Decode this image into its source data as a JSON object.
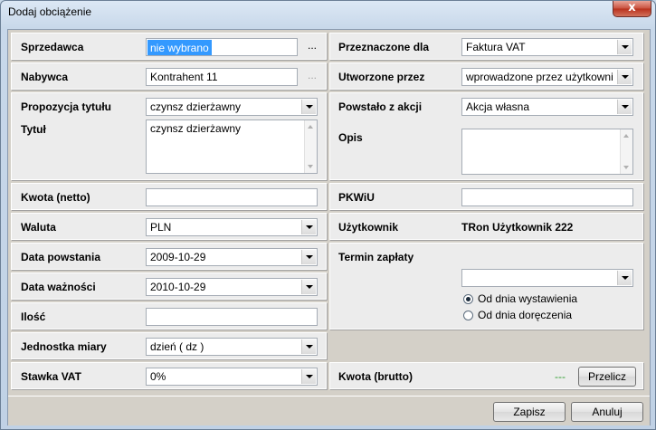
{
  "window": {
    "title": "Dodaj obciążenie",
    "close_label": "x"
  },
  "left": {
    "sprzedawca": {
      "label": "Sprzedawca",
      "value": "nie wybrano",
      "dots": "..."
    },
    "nabywca": {
      "label": "Nabywca",
      "value": "Kontrahent 11",
      "dots": "..."
    },
    "propozycja": {
      "label": "Propozycja tytułu",
      "value": "czynsz dzierżawny"
    },
    "tytul": {
      "label": "Tytuł",
      "value": "czynsz dzierżawny"
    },
    "kwota_netto": {
      "label": "Kwota (netto)",
      "value": ""
    },
    "waluta": {
      "label": "Waluta",
      "value": "PLN"
    },
    "data_powstania": {
      "label": "Data powstania",
      "value": "2009-10-29"
    },
    "data_waznosci": {
      "label": "Data ważności",
      "value": "2010-10-29"
    },
    "ilosc": {
      "label": "Ilość",
      "value": ""
    },
    "jednostka": {
      "label": "Jednostka miary",
      "value": "dzień ( dz )"
    },
    "stawka": {
      "label": "Stawka VAT",
      "value": "0%"
    }
  },
  "right": {
    "przeznaczone": {
      "label": "Przeznaczone dla",
      "value": "Faktura VAT"
    },
    "utworzone": {
      "label": "Utworzone przez",
      "value": "wprowadzone przez użytkowni"
    },
    "powstalo": {
      "label": "Powstało z akcji",
      "value": "Akcja własna"
    },
    "opis": {
      "label": "Opis",
      "value": ""
    },
    "pkwiu": {
      "label": "PKWiU",
      "value": ""
    },
    "uzytkownik": {
      "label": "Użytkownik",
      "value": "TRon Użytkownik 222"
    },
    "termin": {
      "label": "Termin zapłaty",
      "value": "",
      "options": [
        {
          "label": "Od dnia wystawienia",
          "checked": true
        },
        {
          "label": "Od dnia doręczenia",
          "checked": false
        }
      ]
    },
    "kwota_brutto": {
      "label": "Kwota (brutto)",
      "value": "---",
      "button": "Przelicz"
    }
  },
  "footer": {
    "save": "Zapisz",
    "cancel": "Anuluj"
  },
  "colors": {
    "selection": "#3399ff",
    "green_value": "#2f9e2f"
  }
}
